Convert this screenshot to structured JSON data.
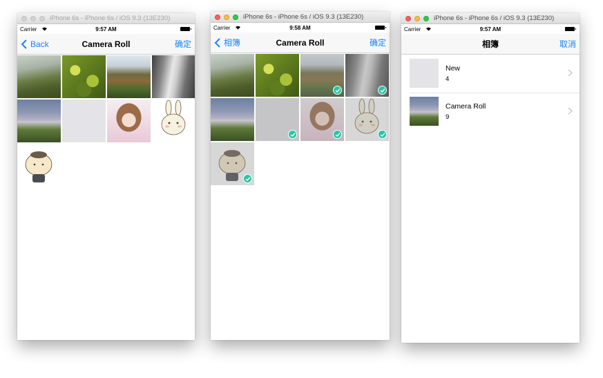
{
  "windows": [
    {
      "title": "iPhone 6s - iPhone 6s / iOS 9.3 (13E230)",
      "carrier": "Carrier",
      "time": "9:57 AM",
      "nav": {
        "back": "Back",
        "title": "Camera Roll",
        "right": "确定"
      },
      "photos": [
        {
          "icon": "meadow-photo",
          "selected": false
        },
        {
          "icon": "leaves-photo",
          "selected": false
        },
        {
          "icon": "waterfall-photo",
          "selected": false
        },
        {
          "icon": "cascade-photo",
          "selected": false
        },
        {
          "icon": "misty-waterfall-photo",
          "selected": false
        },
        {
          "icon": "blank-photo",
          "selected": false
        },
        {
          "icon": "anime-girl-photo",
          "selected": false
        },
        {
          "icon": "bunny-sticker",
          "selected": false
        },
        {
          "icon": "cat-sticker",
          "selected": false
        }
      ]
    },
    {
      "title": "iPhone 6s - iPhone 6s / iOS 9.3 (13E230)",
      "carrier": "Carrier",
      "time": "9:58 AM",
      "nav": {
        "back": "相簿",
        "title": "Camera Roll",
        "right": "确定"
      },
      "photos": [
        {
          "icon": "meadow-photo",
          "selected": false
        },
        {
          "icon": "leaves-photo",
          "selected": false
        },
        {
          "icon": "waterfall-photo",
          "selected": true
        },
        {
          "icon": "cascade-photo",
          "selected": true
        },
        {
          "icon": "misty-waterfall-photo",
          "selected": false
        },
        {
          "icon": "blank-photo",
          "selected": true
        },
        {
          "icon": "anime-girl-photo",
          "selected": true
        },
        {
          "icon": "bunny-sticker",
          "selected": true
        },
        {
          "icon": "cat-sticker",
          "selected": true
        }
      ]
    },
    {
      "title": "iPhone 6s - iPhone 6s / iOS 9.3 (13E230)",
      "carrier": "Carrier",
      "time": "9:57 AM",
      "nav": {
        "title": "相簿",
        "right": "取消"
      },
      "albums": [
        {
          "name": "New",
          "count": "4",
          "icon": "blank-photo"
        },
        {
          "name": "Camera Roll",
          "count": "9",
          "icon": "misty-waterfall-photo"
        }
      ]
    }
  ],
  "colors": {
    "accent": "#1a82fb",
    "check": "#29c3a3"
  }
}
